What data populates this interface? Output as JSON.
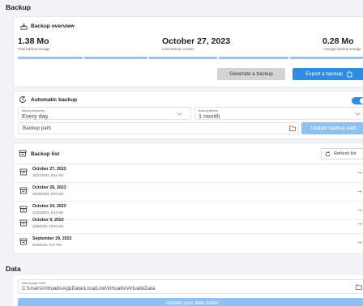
{
  "page": {
    "title": "Backup"
  },
  "overview": {
    "title": "Backup overview",
    "total_value": "1.38 Mo",
    "total_label": "Total backup storage",
    "date_value": "October 27, 2023",
    "date_label": "Last backup creation",
    "avg_value": "0.28 Mo",
    "avg_label": "Average backup storage",
    "generate_label": "Generate a backup",
    "export_label": "Export a backup",
    "colors": {
      "accent": "#2f8ce0",
      "bar": "#9ec3e6"
    }
  },
  "auto": {
    "title": "Automatic backup",
    "enabled": true,
    "frequency_label": "Backup frequency",
    "frequency_value": "Every day",
    "lifetime_label": "Backup lifetime",
    "lifetime_value": "1 month",
    "path_placeholder": "Backup path",
    "update_label": "Update backup path"
  },
  "list": {
    "title": "Backup list",
    "refresh_label": "Refresh list",
    "items": [
      {
        "title": "October 27, 2023",
        "date": "10/27/2023, 9:02 AM"
      },
      {
        "title": "October 26, 2023",
        "date": "10/26/2023, 9:55 AM"
      },
      {
        "title": "October 24, 2023",
        "date": "10/24/2023, 9:43 AM"
      },
      {
        "title": "October 9, 2023",
        "date": "10/9/2023, 10:35 AM"
      },
      {
        "title": "September 29, 2023",
        "date": "9/29/2023, 5:17 PM"
      }
    ]
  },
  "data": {
    "title": "Data",
    "folder_label": "Data storage folder",
    "folder_value": "C:\\Users\\Virtualis\\AppData\\LocalLow\\Virtualis\\VirtualisData",
    "update_label": "Update your data folder"
  }
}
